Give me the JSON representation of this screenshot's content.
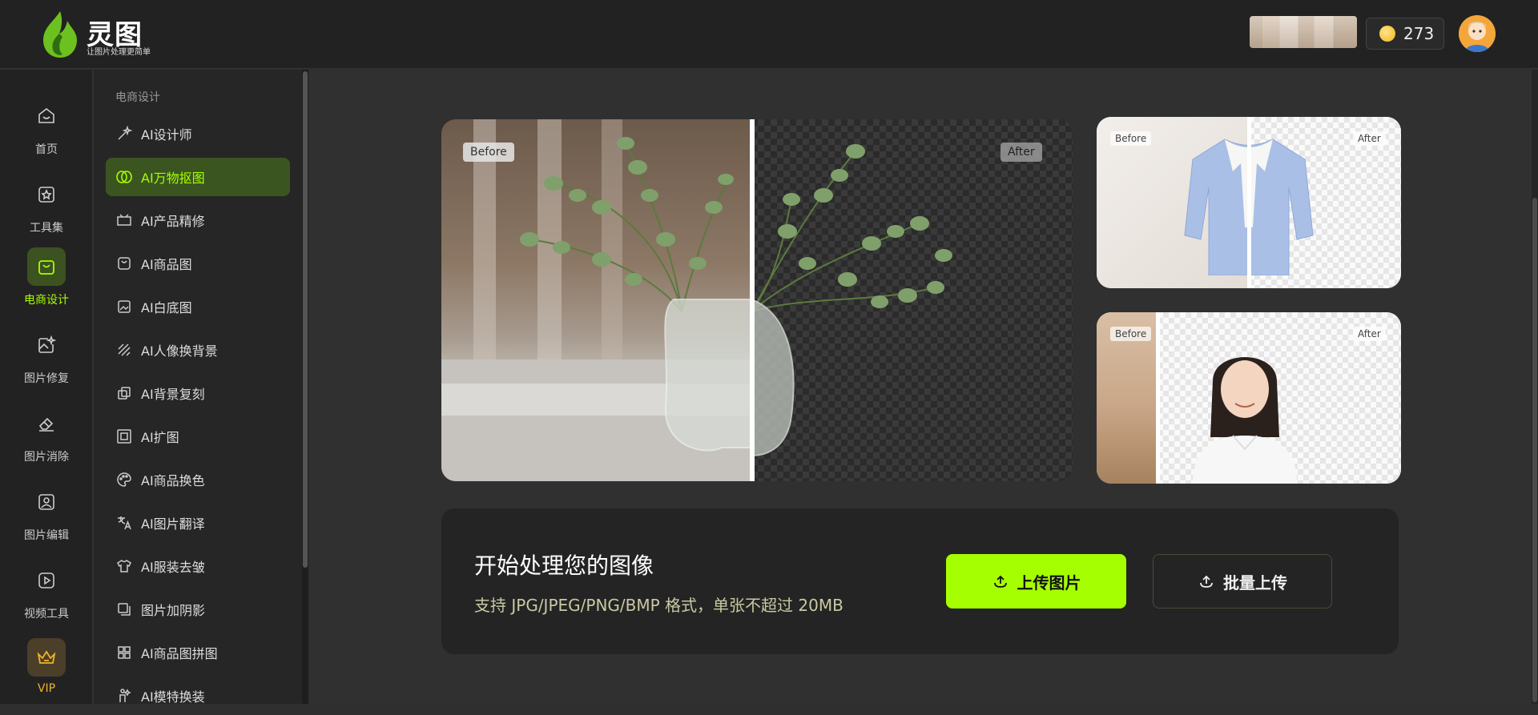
{
  "brand": {
    "name": "灵图",
    "tagline": "让图片处理更简单"
  },
  "header": {
    "coins": "273"
  },
  "leftnav": {
    "items": [
      {
        "label": "首页",
        "icon": "home-icon"
      },
      {
        "label": "工具集",
        "icon": "toolbox-icon"
      },
      {
        "label": "电商设计",
        "icon": "shopping-bag-icon"
      },
      {
        "label": "图片修复",
        "icon": "image-repair-icon"
      },
      {
        "label": "图片消除",
        "icon": "eraser-icon"
      },
      {
        "label": "图片编辑",
        "icon": "image-edit-icon"
      },
      {
        "label": "视频工具",
        "icon": "video-icon"
      },
      {
        "label": "VIP",
        "icon": "crown-icon"
      }
    ]
  },
  "subnav": {
    "heading": "电商设计",
    "items": [
      {
        "label": "AI设计师",
        "icon": "magic-wand-icon"
      },
      {
        "label": "AI万物抠图",
        "icon": "cutout-icon"
      },
      {
        "label": "AI产品精修",
        "icon": "retouch-icon"
      },
      {
        "label": "AI商品图",
        "icon": "product-bag-icon"
      },
      {
        "label": "AI白底图",
        "icon": "white-bg-icon"
      },
      {
        "label": "AI人像换背景",
        "icon": "stripes-icon"
      },
      {
        "label": "AI背景复刻",
        "icon": "copy-icon"
      },
      {
        "label": "AI扩图",
        "icon": "expand-icon"
      },
      {
        "label": "AI商品换色",
        "icon": "palette-icon"
      },
      {
        "label": "AI图片翻译",
        "icon": "translate-icon"
      },
      {
        "label": "AI服装去皱",
        "icon": "shirt-icon"
      },
      {
        "label": "图片加阴影",
        "icon": "shadow-icon"
      },
      {
        "label": "AI商品图拼图",
        "icon": "grid-icon"
      },
      {
        "label": "AI模特换装",
        "icon": "model-icon"
      }
    ]
  },
  "showcase": {
    "before": "Before",
    "after": "After"
  },
  "upload": {
    "title": "开始处理您的图像",
    "subtitle": "支持 JPG/JPEG/PNG/BMP 格式，单张不超过 20MB",
    "primary_label": "上传图片",
    "secondary_label": "批量上传"
  },
  "colors": {
    "accent": "#a6ff00",
    "active_bg": "#3b5521",
    "vip": "#f0b429"
  }
}
